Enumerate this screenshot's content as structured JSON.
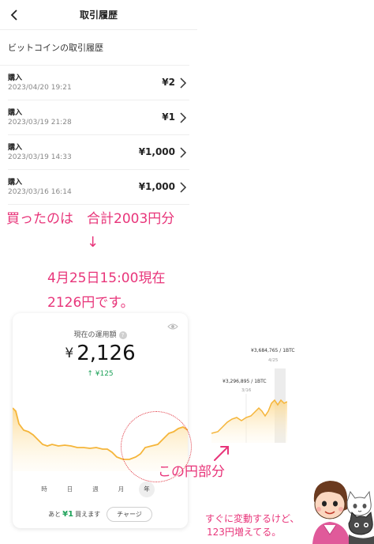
{
  "app": {
    "title": "取引履歴",
    "section_title": "ビットコインの取引履歴",
    "transactions": [
      {
        "type": "購入",
        "date": "2023/04/20 19:21",
        "amount": "¥2"
      },
      {
        "type": "購入",
        "date": "2023/03/19 21:28",
        "amount": "¥1"
      },
      {
        "type": "購入",
        "date": "2023/03/19 14:33",
        "amount": "¥1,000"
      },
      {
        "type": "購入",
        "date": "2023/03/16 16:14",
        "amount": "¥1,000"
      }
    ]
  },
  "annotations": {
    "total": "買ったのは　合計2003円分",
    "arrow": "↓",
    "current_1": "4月25日15:00現在",
    "current_2": "2126円です。",
    "this_part": "この円部分",
    "fluctuate_1": "すぐに変動するけど、",
    "fluctuate_2": "123円増えてる。"
  },
  "portfolio": {
    "label": "現在の運用額",
    "help": "?",
    "currency": "¥",
    "value": "2,126",
    "change": "↑ ¥125",
    "ranges": [
      "時",
      "日",
      "週",
      "月",
      "年"
    ],
    "active_range": "年",
    "buy_prefix": "あと",
    "buy_amount": "¥1",
    "buy_suffix": "買えます",
    "charge": "チャージ"
  },
  "zoom_chart": {
    "high_label": "¥3,684,765 / 1BTC",
    "high_date": "4/25",
    "low_label": "¥3,296,895 / 1BTC",
    "low_date": "3/16"
  },
  "colors": {
    "accent_pink": "#e8357a",
    "positive_green": "#1fa25a",
    "chart_line": "#f5b53a",
    "circle_red": "#e0333e"
  },
  "icons": {
    "back": "chevron-left-icon",
    "row_chevron": "chevron-right-icon",
    "help": "question-icon",
    "visibility": "eye-icon"
  }
}
